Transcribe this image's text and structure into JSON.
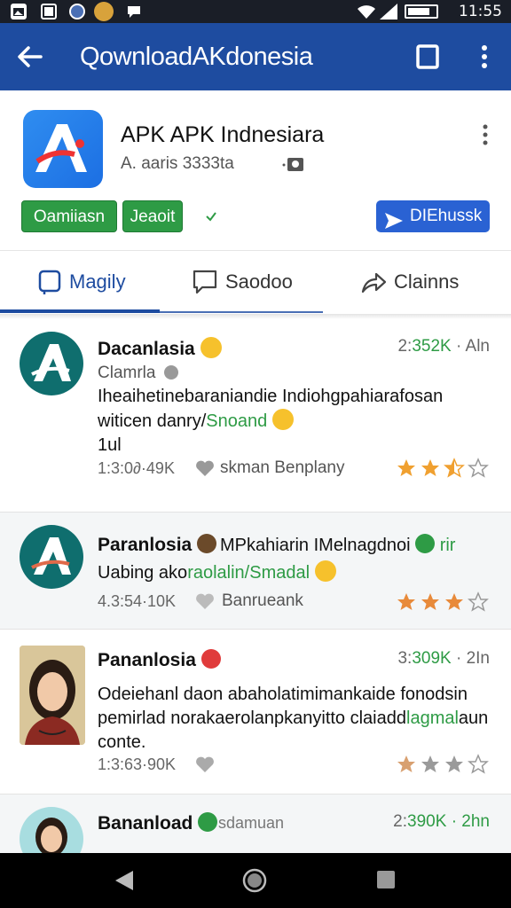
{
  "status_bar": {
    "time": "11:55"
  },
  "app_bar": {
    "title": "QownloadAKdonesia"
  },
  "app": {
    "name": "APK APK Indnesiara",
    "subtitle": "A. aaris 3333ta",
    "tags": [
      "Oamiiasn",
      "Jeaoit"
    ],
    "primary_button": "DIEhussk"
  },
  "tabs": [
    {
      "label": "Magily"
    },
    {
      "label": "Saodoo"
    },
    {
      "label": "Clainns"
    }
  ],
  "reviews": [
    {
      "name": "Dacanlasia",
      "meta_prefix": "2:",
      "meta_count": "352K",
      "meta_suffix": "· Aln",
      "sub": "Clamrla",
      "text_1": "Iheaihetinebaraniandie Indiohgpahiarafosan",
      "text_2_a": "witicen danry/",
      "text_2_b": "Snoand",
      "text_3": "1ul",
      "foot_time": "1:3:0∂·49K",
      "foot_label": "skman Benplany",
      "rating": 2.5
    },
    {
      "name": "Paranlosia",
      "name_extra": "MPkahiarin IMelnagdnoi",
      "name_extra_2": "rir",
      "text_1_a": "Uabing ako",
      "text_1_b": "raolalin/",
      "text_1_c": "Smadal",
      "foot_time": "4.3:54·10K",
      "foot_label": "Banrueank",
      "rating": 3
    },
    {
      "name": "Pananlosia",
      "meta_prefix": "3:",
      "meta_count": "309K",
      "meta_suffix": "· 2In",
      "text_1": "Odeiehanl daon abaholatimimankaide fonodsin",
      "text_2_a": "pemirlad norakaerolanpkanyitto claiadd",
      "text_2_b": "lagmal",
      "text_2_c": "aun",
      "text_3": "conte.",
      "foot_time": "1:3:63·90K",
      "rating": 1
    },
    {
      "name": "Bananload",
      "name_extra": "sdamuan",
      "meta_prefix": "2:",
      "meta_count": "390K",
      "meta_suffix": "· 2hn"
    }
  ],
  "colors": {
    "app_bar": "#1e4ca0",
    "accent_green": "#2e9b45",
    "primary_blue": "#2a62d3",
    "star": "#f0a030"
  }
}
